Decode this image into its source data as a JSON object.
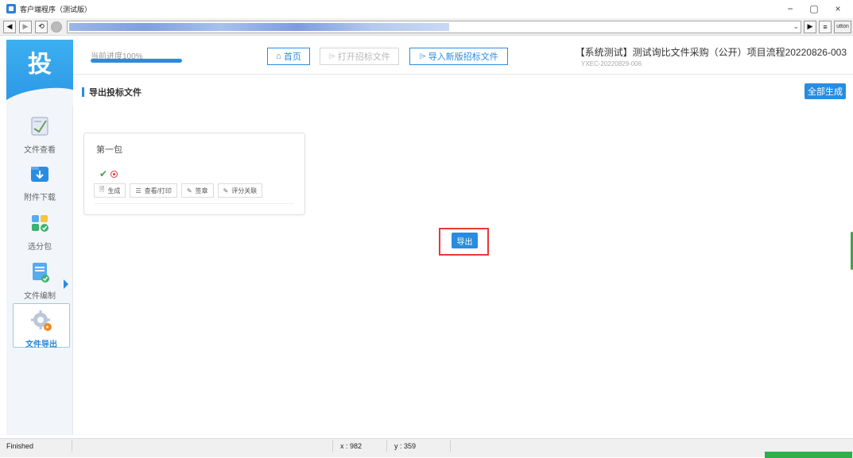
{
  "window": {
    "title": "客户端程序（测试版）",
    "controls": [
      "−",
      "▢",
      "×"
    ]
  },
  "navbar": {
    "buttons": [
      "◀",
      "▶",
      "⟲",
      "●"
    ],
    "right_buttons": [
      "▶",
      "≡"
    ],
    "button_label": "utton",
    "dropdown": "⌄"
  },
  "sidebar": {
    "logo": "投",
    "items": [
      {
        "label": "文件查看",
        "icon": "document-view-icon"
      },
      {
        "label": "附件下载",
        "icon": "folder-download-icon"
      },
      {
        "label": "选分包",
        "icon": "package-select-icon"
      },
      {
        "label": "文件编制",
        "icon": "file-edit-icon"
      },
      {
        "label": "文件导出",
        "icon": "gear-export-icon",
        "active": true
      }
    ]
  },
  "topbar": {
    "progress_label": "当前进度100%",
    "progress_value": 1.0,
    "home": "首页",
    "open_tender": "打开招标文件",
    "import_tender": "导入新版招标文件",
    "project_title": "【系统测试】测试询比文件采购（公开）项目流程20220826-003",
    "project_code": "YXEC-20220829-006"
  },
  "main": {
    "section_title": "导出投标文件",
    "generate_all": "全部生成",
    "package": {
      "title": "第一包",
      "actions": [
        {
          "icon": "generate-icon",
          "glyph": "🗎",
          "label": "生成"
        },
        {
          "icon": "view-print-icon",
          "glyph": "☰",
          "label": "查看/打印"
        },
        {
          "icon": "sign-icon",
          "glyph": "✎",
          "label": "签章"
        },
        {
          "icon": "score-link-icon",
          "glyph": "✎",
          "label": "评分关联"
        }
      ]
    },
    "export_button": "导出"
  },
  "statusbar": {
    "status": "Finished",
    "x": "x : 982",
    "y": "y : 359"
  },
  "colors": {
    "primary": "#2a8ce0",
    "highlight": "#e53935",
    "success": "#43a047"
  }
}
